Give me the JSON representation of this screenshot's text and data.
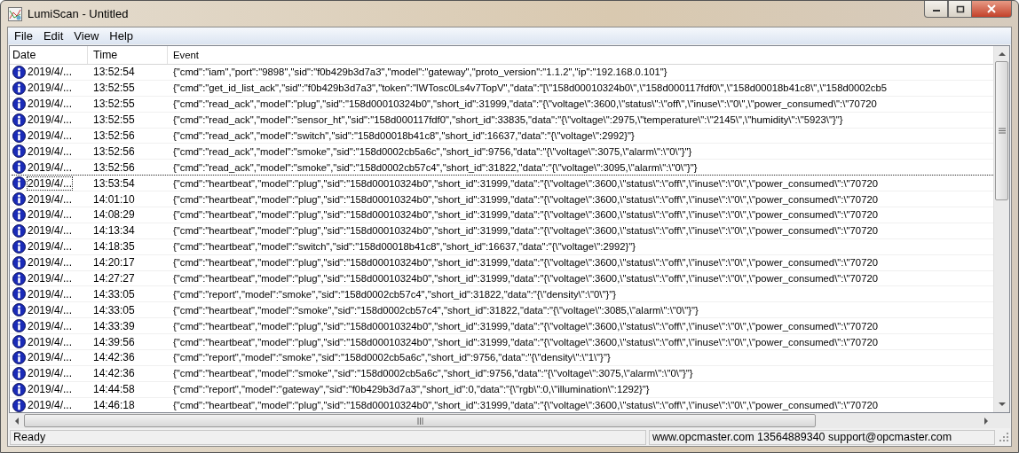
{
  "window": {
    "title": "LumiScan - Untitled"
  },
  "menu": [
    "File",
    "Edit",
    "View",
    "Help"
  ],
  "table": {
    "columns": [
      "Date",
      "Time",
      "Event"
    ],
    "rows": [
      {
        "date": "2019/4/...",
        "time": "13:52:54",
        "event": "{\"cmd\":\"iam\",\"port\":\"9898\",\"sid\":\"f0b429b3d7a3\",\"model\":\"gateway\",\"proto_version\":\"1.1.2\",\"ip\":\"192.168.0.101\"}",
        "focused": false
      },
      {
        "date": "2019/4/...",
        "time": "13:52:55",
        "event": "{\"cmd\":\"get_id_list_ack\",\"sid\":\"f0b429b3d7a3\",\"token\":\"lWTosc0Ls4v7TopV\",\"data\":\"[\\\"158d00010324b0\\\",\\\"158d000117fdf0\\\",\\\"158d00018b41c8\\\",\\\"158d0002cb5",
        "focused": false
      },
      {
        "date": "2019/4/...",
        "time": "13:52:55",
        "event": "{\"cmd\":\"read_ack\",\"model\":\"plug\",\"sid\":\"158d00010324b0\",\"short_id\":31999,\"data\":\"{\\\"voltage\\\":3600,\\\"status\\\":\\\"off\\\",\\\"inuse\\\":\\\"0\\\",\\\"power_consumed\\\":\\\"70720",
        "focused": false
      },
      {
        "date": "2019/4/...",
        "time": "13:52:55",
        "event": "{\"cmd\":\"read_ack\",\"model\":\"sensor_ht\",\"sid\":\"158d000117fdf0\",\"short_id\":33835,\"data\":\"{\\\"voltage\\\":2975,\\\"temperature\\\":\\\"2145\\\",\\\"humidity\\\":\\\"5923\\\"}\"}",
        "focused": false
      },
      {
        "date": "2019/4/...",
        "time": "13:52:56",
        "event": "{\"cmd\":\"read_ack\",\"model\":\"switch\",\"sid\":\"158d00018b41c8\",\"short_id\":16637,\"data\":\"{\\\"voltage\\\":2992}\"}",
        "focused": false
      },
      {
        "date": "2019/4/...",
        "time": "13:52:56",
        "event": "{\"cmd\":\"read_ack\",\"model\":\"smoke\",\"sid\":\"158d0002cb5a6c\",\"short_id\":9756,\"data\":\"{\\\"voltage\\\":3075,\\\"alarm\\\":\\\"0\\\"}\"}",
        "focused": false
      },
      {
        "date": "2019/4/...",
        "time": "13:52:56",
        "event": "{\"cmd\":\"read_ack\",\"model\":\"smoke\",\"sid\":\"158d0002cb57c4\",\"short_id\":31822,\"data\":\"{\\\"voltage\\\":3095,\\\"alarm\\\":\\\"0\\\"}\"}",
        "focused": false
      },
      {
        "date": "2019/4/...",
        "time": "13:53:54",
        "event": "{\"cmd\":\"heartbeat\",\"model\":\"plug\",\"sid\":\"158d00010324b0\",\"short_id\":31999,\"data\":\"{\\\"voltage\\\":3600,\\\"status\\\":\\\"off\\\",\\\"inuse\\\":\\\"0\\\",\\\"power_consumed\\\":\\\"70720",
        "focused": true
      },
      {
        "date": "2019/4/...",
        "time": "14:01:10",
        "event": "{\"cmd\":\"heartbeat\",\"model\":\"plug\",\"sid\":\"158d00010324b0\",\"short_id\":31999,\"data\":\"{\\\"voltage\\\":3600,\\\"status\\\":\\\"off\\\",\\\"inuse\\\":\\\"0\\\",\\\"power_consumed\\\":\\\"70720",
        "focused": false
      },
      {
        "date": "2019/4/...",
        "time": "14:08:29",
        "event": "{\"cmd\":\"heartbeat\",\"model\":\"plug\",\"sid\":\"158d00010324b0\",\"short_id\":31999,\"data\":\"{\\\"voltage\\\":3600,\\\"status\\\":\\\"off\\\",\\\"inuse\\\":\\\"0\\\",\\\"power_consumed\\\":\\\"70720",
        "focused": false
      },
      {
        "date": "2019/4/...",
        "time": "14:13:34",
        "event": "{\"cmd\":\"heartbeat\",\"model\":\"plug\",\"sid\":\"158d00010324b0\",\"short_id\":31999,\"data\":\"{\\\"voltage\\\":3600,\\\"status\\\":\\\"off\\\",\\\"inuse\\\":\\\"0\\\",\\\"power_consumed\\\":\\\"70720",
        "focused": false
      },
      {
        "date": "2019/4/...",
        "time": "14:18:35",
        "event": "{\"cmd\":\"heartbeat\",\"model\":\"switch\",\"sid\":\"158d00018b41c8\",\"short_id\":16637,\"data\":\"{\\\"voltage\\\":2992}\"}",
        "focused": false
      },
      {
        "date": "2019/4/...",
        "time": "14:20:17",
        "event": "{\"cmd\":\"heartbeat\",\"model\":\"plug\",\"sid\":\"158d00010324b0\",\"short_id\":31999,\"data\":\"{\\\"voltage\\\":3600,\\\"status\\\":\\\"off\\\",\\\"inuse\\\":\\\"0\\\",\\\"power_consumed\\\":\\\"70720",
        "focused": false
      },
      {
        "date": "2019/4/...",
        "time": "14:27:27",
        "event": "{\"cmd\":\"heartbeat\",\"model\":\"plug\",\"sid\":\"158d00010324b0\",\"short_id\":31999,\"data\":\"{\\\"voltage\\\":3600,\\\"status\\\":\\\"off\\\",\\\"inuse\\\":\\\"0\\\",\\\"power_consumed\\\":\\\"70720",
        "focused": false
      },
      {
        "date": "2019/4/...",
        "time": "14:33:05",
        "event": "{\"cmd\":\"report\",\"model\":\"smoke\",\"sid\":\"158d0002cb57c4\",\"short_id\":31822,\"data\":\"{\\\"density\\\":\\\"0\\\"}\"}",
        "focused": false
      },
      {
        "date": "2019/4/...",
        "time": "14:33:05",
        "event": "{\"cmd\":\"heartbeat\",\"model\":\"smoke\",\"sid\":\"158d0002cb57c4\",\"short_id\":31822,\"data\":\"{\\\"voltage\\\":3085,\\\"alarm\\\":\\\"0\\\"}\"}",
        "focused": false
      },
      {
        "date": "2019/4/...",
        "time": "14:33:39",
        "event": "{\"cmd\":\"heartbeat\",\"model\":\"plug\",\"sid\":\"158d00010324b0\",\"short_id\":31999,\"data\":\"{\\\"voltage\\\":3600,\\\"status\\\":\\\"off\\\",\\\"inuse\\\":\\\"0\\\",\\\"power_consumed\\\":\\\"70720",
        "focused": false
      },
      {
        "date": "2019/4/...",
        "time": "14:39:56",
        "event": "{\"cmd\":\"heartbeat\",\"model\":\"plug\",\"sid\":\"158d00010324b0\",\"short_id\":31999,\"data\":\"{\\\"voltage\\\":3600,\\\"status\\\":\\\"off\\\",\\\"inuse\\\":\\\"0\\\",\\\"power_consumed\\\":\\\"70720",
        "focused": false
      },
      {
        "date": "2019/4/...",
        "time": "14:42:36",
        "event": "{\"cmd\":\"report\",\"model\":\"smoke\",\"sid\":\"158d0002cb5a6c\",\"short_id\":9756,\"data\":\"{\\\"density\\\":\\\"1\\\"}\"}",
        "focused": false
      },
      {
        "date": "2019/4/...",
        "time": "14:42:36",
        "event": "{\"cmd\":\"heartbeat\",\"model\":\"smoke\",\"sid\":\"158d0002cb5a6c\",\"short_id\":9756,\"data\":\"{\\\"voltage\\\":3075,\\\"alarm\\\":\\\"0\\\"}\"}",
        "focused": false
      },
      {
        "date": "2019/4/...",
        "time": "14:44:58",
        "event": "{\"cmd\":\"report\",\"model\":\"gateway\",\"sid\":\"f0b429b3d7a3\",\"short_id\":0,\"data\":\"{\\\"rgb\\\":0,\\\"illumination\\\":1292}\"}",
        "focused": false
      },
      {
        "date": "2019/4/...",
        "time": "14:46:18",
        "event": "{\"cmd\":\"heartbeat\",\"model\":\"plug\",\"sid\":\"158d00010324b0\",\"short_id\":31999,\"data\":\"{\\\"voltage\\\":3600,\\\"status\\\":\\\"off\\\",\\\"inuse\\\":\\\"0\\\",\\\"power_consumed\\\":\\\"70720",
        "focused": false
      }
    ]
  },
  "status_bar": {
    "message": "Ready",
    "contact": "www.opcmaster.com 13564889340 support@opcmaster.com"
  }
}
